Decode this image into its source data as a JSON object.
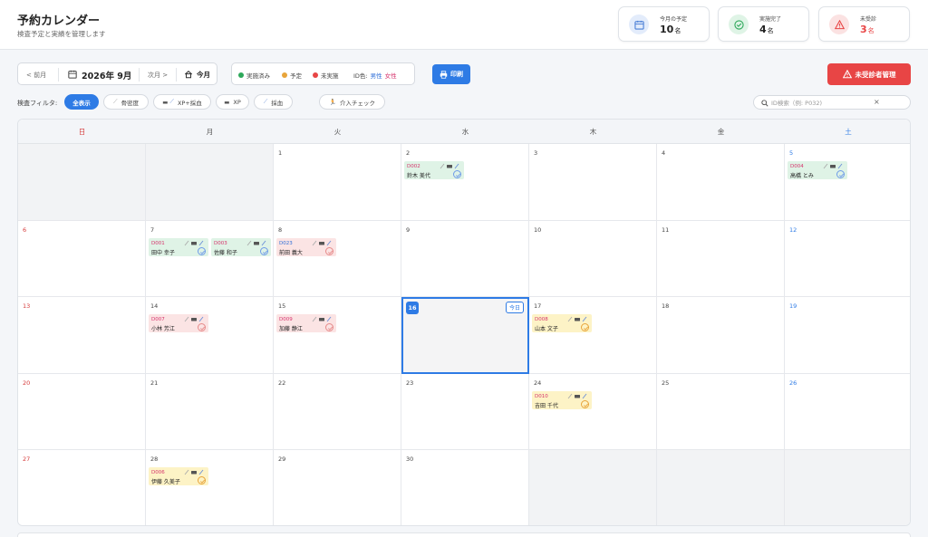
{
  "header": {
    "title": "予約カレンダー",
    "subtitle": "検査予定と実績を管理します"
  },
  "stats": [
    {
      "label": "今月の予定",
      "value": "10",
      "unit": "名",
      "icon": "calendar-icon",
      "color": "#4a7fd6"
    },
    {
      "label": "実施完了",
      "value": "4",
      "unit": "名",
      "icon": "check-circle-icon",
      "color": "#2da85a"
    },
    {
      "label": "未受診",
      "value": "3",
      "unit": "名",
      "icon": "warning-icon",
      "color": "#e84545"
    }
  ],
  "nav": {
    "prev": "< 前月",
    "month": "2026年 9月",
    "next": "次月 >",
    "today": "今月"
  },
  "legend": {
    "done": "実施済み",
    "scheduled": "予定",
    "not_done": "未実施",
    "id_color": "ID色:",
    "male": "男性",
    "female": "女性",
    "colors": {
      "done": "#2da85a",
      "scheduled": "#e8a43a",
      "not_done": "#e84545",
      "male": "#2e6fd8",
      "female": "#d6336c"
    }
  },
  "buttons": {
    "print": "印刷",
    "unexamined": "未受診者管理"
  },
  "filter": {
    "label": "検査フィルタ:",
    "chips": [
      "全表示",
      "骨密度",
      "XP+採血",
      "XP",
      "採血",
      "介入チェック"
    ]
  },
  "search": {
    "placeholder": "ID検索（例: P032)",
    "clear": "×"
  },
  "calendar": {
    "weekdays": [
      "日",
      "月",
      "火",
      "水",
      "木",
      "金",
      "土"
    ],
    "today_label": "今日",
    "days": [
      "1",
      "2",
      "3",
      "4",
      "5",
      "6",
      "7",
      "8",
      "9",
      "10",
      "11",
      "12",
      "13",
      "14",
      "15",
      "16",
      "17",
      "18",
      "19",
      "20",
      "21",
      "22",
      "23",
      "24",
      "25",
      "26",
      "27",
      "28",
      "29",
      "30"
    ],
    "appointments": [
      {
        "id": "D002",
        "name": "鈴木 美代",
        "date": "2",
        "status": "done",
        "gender": "female"
      },
      {
        "id": "D004",
        "name": "高橋 とみ",
        "date": "5",
        "status": "done",
        "gender": "female"
      },
      {
        "id": "D001",
        "name": "田中 幸子",
        "date": "7",
        "status": "done",
        "gender": "female"
      },
      {
        "id": "D003",
        "name": "佐藤 和子",
        "date": "7",
        "status": "done",
        "gender": "female"
      },
      {
        "id": "D023",
        "name": "前田 義大",
        "date": "8",
        "status": "not_done",
        "gender": "male"
      },
      {
        "id": "D007",
        "name": "小林 芳江",
        "date": "14",
        "status": "not_done",
        "gender": "female"
      },
      {
        "id": "D009",
        "name": "加藤 静江",
        "date": "15",
        "status": "not_done",
        "gender": "female"
      },
      {
        "id": "D008",
        "name": "山本 文子",
        "date": "17",
        "status": "scheduled",
        "gender": "female"
      },
      {
        "id": "D010",
        "name": "吉田 千代",
        "date": "24",
        "status": "scheduled",
        "gender": "female"
      },
      {
        "id": "D006",
        "name": "伊藤 久美子",
        "date": "28",
        "status": "scheduled",
        "gender": "female"
      }
    ]
  }
}
